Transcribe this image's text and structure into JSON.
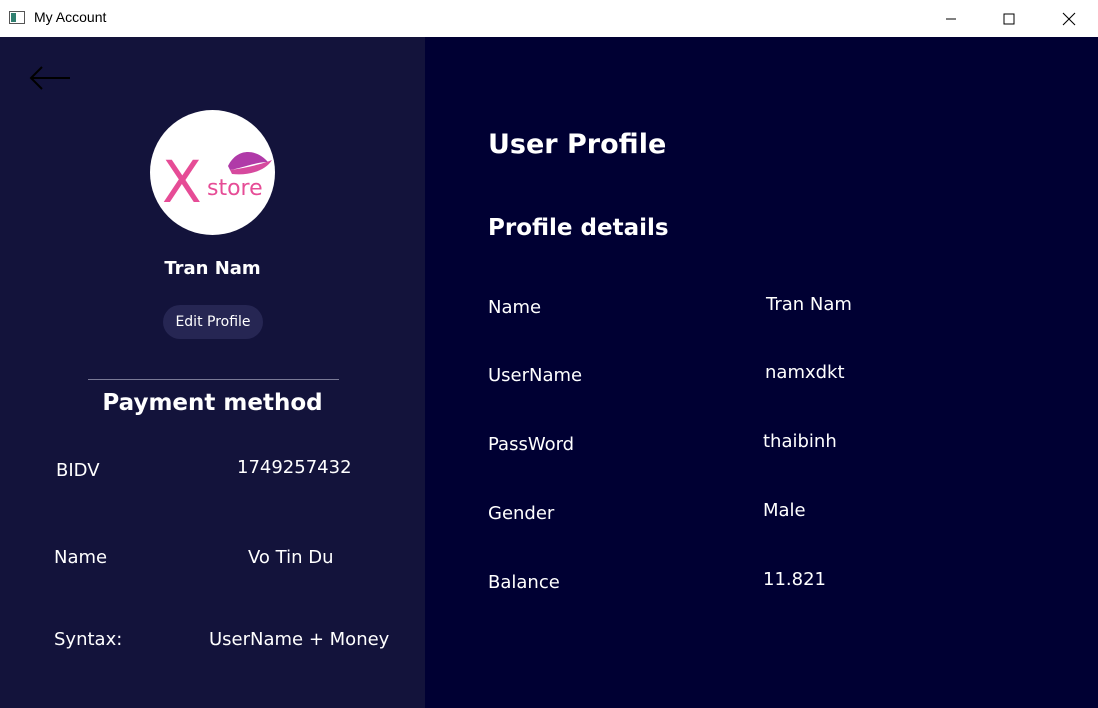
{
  "window": {
    "title": "My Account"
  },
  "colors": {
    "left_panel_bg": "#13133b",
    "right_panel_bg": "#000033",
    "button_bg": "#262653",
    "logo_pink": "#e64c96",
    "logo_purple": "#b03aa8"
  },
  "sidebar": {
    "back_icon": "arrow-left-icon",
    "avatar": {
      "logo_letter": "X",
      "logo_text": "store"
    },
    "user_name": "Tran Nam",
    "edit_profile_label": "Edit Profile",
    "payment": {
      "title": "Payment method",
      "rows": [
        {
          "label": "BIDV",
          "value": "1749257432"
        },
        {
          "label": "Name",
          "value": "Vo Tin Du"
        },
        {
          "label": "Syntax:",
          "value": "UserName + Money"
        }
      ]
    }
  },
  "main": {
    "title": "User Profile",
    "subtitle": "Profile details",
    "fields": [
      {
        "label": "Name",
        "value": "Tran Nam"
      },
      {
        "label": "UserName",
        "value": "namxdkt"
      },
      {
        "label": "PassWord",
        "value": "thaibinh"
      },
      {
        "label": "Gender",
        "value": "Male"
      },
      {
        "label": "Balance",
        "value": "11.821"
      }
    ]
  }
}
